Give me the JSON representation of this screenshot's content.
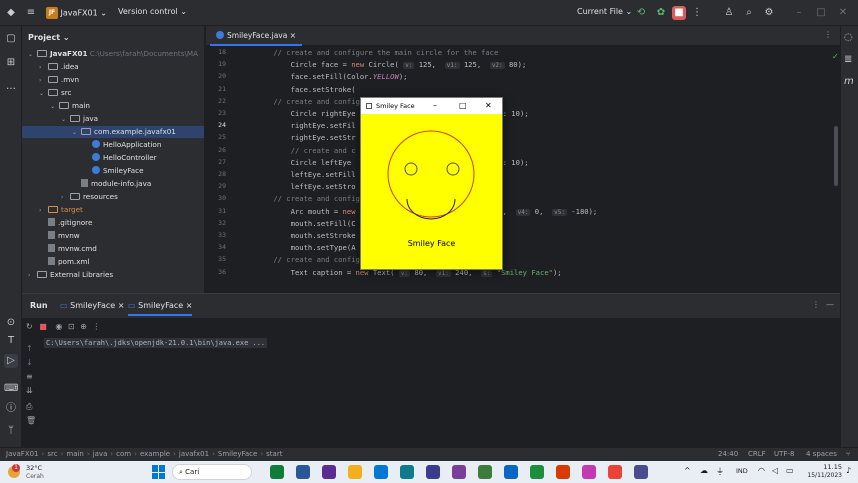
{
  "titlebar": {
    "project_badge": "JF",
    "project_name": "JavaFX01 ⌄",
    "vcs": "Version control ⌄",
    "run_config": "Current File ⌄"
  },
  "project_panel": {
    "title": "Project ⌄",
    "tree": [
      {
        "text": "JavaFX01",
        "hint": "C:\\Users\\farah\\Documents\\MA",
        "kind": "folder",
        "chev": "⌄",
        "indent": 0
      },
      {
        "text": ".idea",
        "kind": "folder",
        "chev": "›",
        "indent": 1
      },
      {
        "text": ".mvn",
        "kind": "folder",
        "chev": "›",
        "indent": 1
      },
      {
        "text": "src",
        "kind": "folder",
        "chev": "⌄",
        "indent": 1
      },
      {
        "text": "main",
        "kind": "folder",
        "chev": "⌄",
        "indent": 2
      },
      {
        "text": "java",
        "kind": "folder",
        "chev": "⌄",
        "indent": 3
      },
      {
        "text": "com.example.javafx01",
        "kind": "folder",
        "chev": "⌄",
        "indent": 4
      },
      {
        "text": "HelloApplication",
        "kind": "class",
        "chev": "",
        "indent": 5
      },
      {
        "text": "HelloController",
        "kind": "class",
        "chev": "",
        "indent": 5
      },
      {
        "text": "SmileyFace",
        "kind": "class",
        "chev": "",
        "indent": 5
      },
      {
        "text": "module-info.java",
        "kind": "file",
        "chev": "",
        "indent": 4
      },
      {
        "text": "resources",
        "kind": "folder",
        "chev": "›",
        "indent": 3
      },
      {
        "text": "target",
        "kind": "folder-orange",
        "chev": "›",
        "indent": 1
      },
      {
        "text": ".gitignore",
        "kind": "file",
        "chev": "",
        "indent": 1
      },
      {
        "text": "mvnw",
        "kind": "file",
        "chev": "",
        "indent": 1
      },
      {
        "text": "mvnw.cmd",
        "kind": "file",
        "chev": "",
        "indent": 1
      },
      {
        "text": "pom.xml",
        "kind": "file",
        "chev": "",
        "indent": 1
      },
      {
        "text": "External Libraries",
        "kind": "folder",
        "chev": "›",
        "indent": 0
      }
    ]
  },
  "editor": {
    "tab": "SmileyFace.java ×",
    "line_numbers": [
      "18",
      "19",
      "20",
      "21",
      "22",
      "23",
      "24",
      "25",
      "26",
      "27",
      "28",
      "29",
      "30",
      "31",
      "32",
      "33",
      "34",
      "35",
      "36"
    ],
    "lines": [
      "    // create and configure the main circle for the face",
      "        Circle face = new Circle( v: 125,  v1: 125,  v2: 80);",
      "        face.setFill(Color.YELLOW);",
      "        face.setStroke(",
      "    // create and configure",
      "        Circle rightEye                                  : 10);",
      "        rightEye.setFil",
      "        rightEye.setStr",
      "        // create and c                              eye",
      "        Circle leftEye                                   : 10);",
      "        leftEye.setFill",
      "        leftEye.setStro",
      "    // create and configure",
      "        Arc mouth = new                                35,  v4: 0,  v5: -180);",
      "        mouth.setFill(C",
      "        mouth.setStroke",
      "        mouth.setType(A",
      "    // create and configure the text",
      "        Text caption = new Text( v: 80,  v1: 240,  s: \"Smiley Face\");"
    ]
  },
  "fx_window": {
    "title": "Smiley Face",
    "caption": "Smiley Face",
    "face_fill": "#ffff00",
    "stroke": "#d93a1c"
  },
  "run": {
    "label": "Run",
    "tab1": "SmileyFace ×",
    "tab2": "SmileyFace ×",
    "console": "C:\\Users\\farah\\.jdks\\openjdk-21.0.1\\bin\\java.exe ..."
  },
  "statusbar": {
    "breadcrumb": [
      "JavaFX01",
      "src",
      "main",
      "java",
      "com",
      "example",
      "javafx01",
      "SmileyFace",
      "start"
    ],
    "position": "24:40",
    "line_sep": "CRLF",
    "encoding": "UTF-8",
    "indent": "4 spaces"
  },
  "taskbar": {
    "temp": "32°C",
    "weather": "Cerah",
    "search": "Cari",
    "lang": "IND",
    "time": "11.15",
    "date": "15/11/2023",
    "notif": "1"
  }
}
